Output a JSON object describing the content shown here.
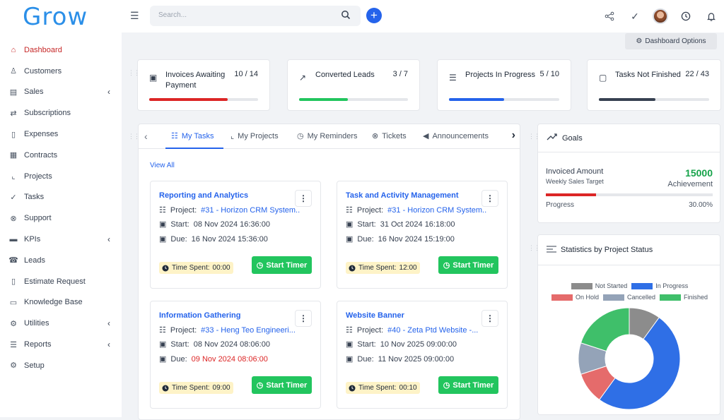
{
  "app": {
    "logo": "Grow"
  },
  "sidebar": {
    "items": [
      {
        "label": "Dashboard",
        "icon": "home-icon",
        "glyph": "⌂",
        "active": true,
        "chevron": false
      },
      {
        "label": "Customers",
        "icon": "user-icon",
        "glyph": "♙",
        "active": false,
        "chevron": false
      },
      {
        "label": "Sales",
        "icon": "receipt-icon",
        "glyph": "▤",
        "active": false,
        "chevron": true
      },
      {
        "label": "Subscriptions",
        "icon": "repeat-icon",
        "glyph": "⇄",
        "active": false,
        "chevron": false
      },
      {
        "label": "Expenses",
        "icon": "file-icon",
        "glyph": "▯",
        "active": false,
        "chevron": false
      },
      {
        "label": "Contracts",
        "icon": "contract-icon",
        "glyph": "▦",
        "active": false,
        "chevron": false
      },
      {
        "label": "Projects",
        "icon": "chart-icon",
        "glyph": "⌞",
        "active": false,
        "chevron": false
      },
      {
        "label": "Tasks",
        "icon": "check-circle-icon",
        "glyph": "✓",
        "active": false,
        "chevron": false
      },
      {
        "label": "Support",
        "icon": "lifebuoy-icon",
        "glyph": "⊗",
        "active": false,
        "chevron": false
      },
      {
        "label": "KPIs",
        "icon": "kpi-icon",
        "glyph": "▬",
        "active": false,
        "chevron": true
      },
      {
        "label": "Leads",
        "icon": "tty-icon",
        "glyph": "☎",
        "active": false,
        "chevron": false
      },
      {
        "label": "Estimate Request",
        "icon": "document-icon",
        "glyph": "▯",
        "active": false,
        "chevron": false
      },
      {
        "label": "Knowledge Base",
        "icon": "folder-icon",
        "glyph": "▭",
        "active": false,
        "chevron": false
      },
      {
        "label": "Utilities",
        "icon": "cogs-icon",
        "glyph": "⚙",
        "active": false,
        "chevron": true
      },
      {
        "label": "Reports",
        "icon": "reports-icon",
        "glyph": "☰",
        "active": false,
        "chevron": true
      },
      {
        "label": "Setup",
        "icon": "gear-icon",
        "glyph": "⚙",
        "active": false,
        "chevron": false
      }
    ]
  },
  "topbar": {
    "search_placeholder": "Search..."
  },
  "dashboard_options_label": "Dashboard Options",
  "stats": [
    {
      "title_line1": "Invoices Awaiting",
      "title_line2": "Payment",
      "count": "10 / 14",
      "progress": 0.72,
      "color": "#dc2626",
      "icon": "invoice-icon"
    },
    {
      "title_line1": "Converted Leads",
      "title_line2": "",
      "count": "3 / 7",
      "progress": 0.45,
      "color": "#22c55e",
      "icon": "trend-up-icon"
    },
    {
      "title_line1": "Projects In Progress",
      "title_line2": "",
      "count": "5 / 10",
      "progress": 0.5,
      "color": "#2563eb",
      "icon": "sliders-icon"
    },
    {
      "title_line1": "Tasks Not Finished",
      "title_line2": "",
      "count": "22 / 43",
      "progress": 0.51,
      "color": "#374151",
      "icon": "task-file-icon"
    }
  ],
  "tabs": [
    {
      "label": "My Tasks",
      "icon": "list-check-icon"
    },
    {
      "label": "My Projects",
      "icon": "chart-icon"
    },
    {
      "label": "My Reminders",
      "icon": "clock-icon"
    },
    {
      "label": "Tickets",
      "icon": "lifebuoy-icon"
    },
    {
      "label": "Announcements",
      "icon": "megaphone-icon"
    }
  ],
  "view_all": "View All",
  "project_label": "Project:",
  "start_label": "Start:",
  "due_label": "Due:",
  "start_timer_label": "Start Timer",
  "time_spent_label": "Time Spent:",
  "tasks": [
    {
      "title": "Reporting and Analytics",
      "project": "#31 - Horizon CRM System...",
      "start": "08 Nov 2024 16:36:00",
      "due": "16 Nov 2024 15:36:00",
      "overdue": false,
      "spent": "00:00"
    },
    {
      "title": "Task and Activity Management",
      "project": "#31 - Horizon CRM System...",
      "start": "31 Oct 2024 16:18:00",
      "due": "16 Nov 2024 15:19:00",
      "overdue": false,
      "spent": "12:00"
    },
    {
      "title": "Information Gathering",
      "project": "#33 - Heng Teo Engineeri...",
      "start": "08 Nov 2024 08:06:00",
      "due": "09 Nov 2024 08:06:00",
      "overdue": true,
      "spent": "09:00"
    },
    {
      "title": "Website Banner",
      "project": "#40 - Zeta Ptd Website -...",
      "start": "10 Nov 2025 09:00:00",
      "due": "11 Nov 2025 09:00:00",
      "overdue": false,
      "spent": "00:10"
    }
  ],
  "goals": {
    "title": "Goals",
    "label": "Invoiced Amount",
    "sub": "Weekly Sales Target",
    "value": "15000",
    "achievement": "Achievement",
    "progress_label": "Progress",
    "percent": "30.00%",
    "progress": 0.3
  },
  "project_status": {
    "title": "Statistics by Project Status"
  },
  "chart_data": {
    "type": "pie",
    "title": "Statistics by Project Status",
    "series": [
      {
        "name": "Not Started",
        "value": 1,
        "color": "#8c8c8c"
      },
      {
        "name": "In Progress",
        "value": 5,
        "color": "#2f6fe6"
      },
      {
        "name": "On Hold",
        "value": 1,
        "color": "#e56b6b"
      },
      {
        "name": "Cancelled",
        "value": 1,
        "color": "#94a3b8"
      },
      {
        "name": "Finished",
        "value": 2,
        "color": "#3fbf6a"
      }
    ],
    "legend": "top"
  }
}
